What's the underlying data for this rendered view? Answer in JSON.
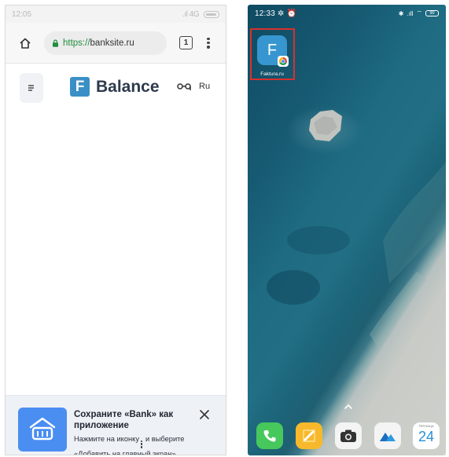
{
  "left_phone": {
    "status_bar": {
      "time": "12:05",
      "network": "4G"
    },
    "browser": {
      "url_scheme": "https://",
      "url_host": "banksite.ru",
      "tab_count": "1"
    },
    "site": {
      "logo_letter": "F",
      "logo_text": "Balance",
      "language": "Ru"
    },
    "install_banner": {
      "title": "Сохраните «Bank» как приложение",
      "text_before": "Нажмите на иконку",
      "text_after": "и выберите «Добавить на главный экран»"
    }
  },
  "right_phone": {
    "status_bar": {
      "time": "12:33",
      "battery": "90"
    },
    "home_app": {
      "letter": "F",
      "label": "Faktura.ru"
    },
    "calendar": {
      "weekday": "Пятница",
      "day": "24"
    }
  },
  "colors": {
    "highlight": "#d9312d",
    "app_icon": "#3796cf",
    "banner_icon": "#4b8ef2"
  }
}
